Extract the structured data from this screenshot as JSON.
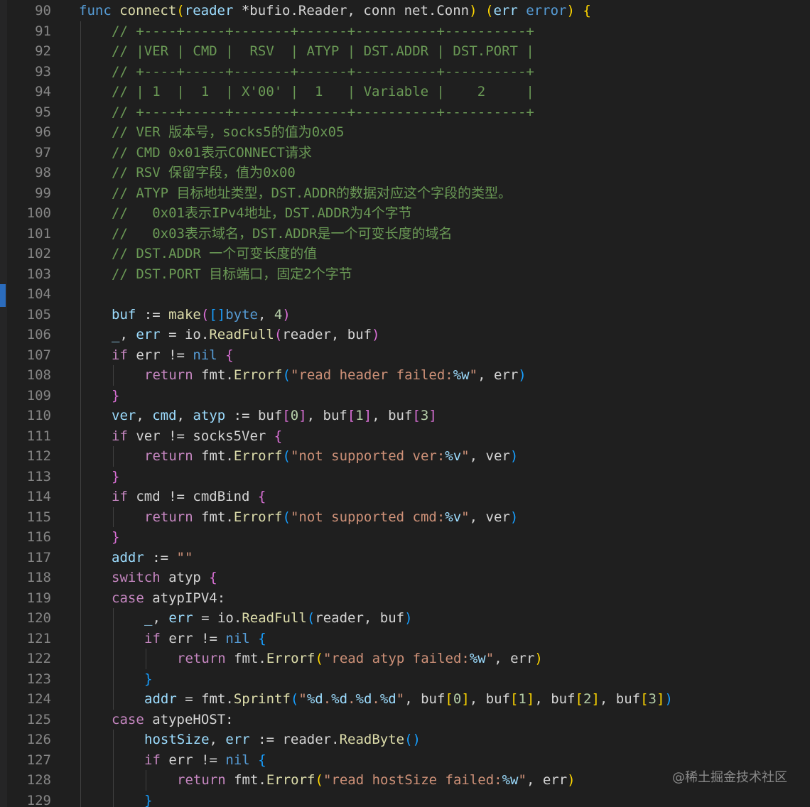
{
  "editor": {
    "lines": [
      {
        "n": "90",
        "indent": 0,
        "tokens": [
          [
            "t-kw",
            "func"
          ],
          [
            "t-plain",
            " "
          ],
          [
            "t-fn",
            "connect"
          ],
          [
            "t-b1",
            "("
          ],
          [
            "t-var",
            "reader"
          ],
          [
            "t-plain",
            " *bufio.Reader, conn net.Conn"
          ],
          [
            "t-b1",
            ")"
          ],
          [
            "t-plain",
            " "
          ],
          [
            "t-b1",
            "("
          ],
          [
            "t-var",
            "err"
          ],
          [
            "t-plain",
            " "
          ],
          [
            "t-kw",
            "error"
          ],
          [
            "t-b1",
            ")"
          ],
          [
            "t-plain",
            " "
          ],
          [
            "t-b1",
            "{"
          ]
        ]
      },
      {
        "n": "91",
        "indent": 1,
        "tokens": [
          [
            "t-com",
            "// +----+-----+-------+------+----------+----------+"
          ]
        ]
      },
      {
        "n": "92",
        "indent": 1,
        "tokens": [
          [
            "t-com",
            "// |VER | CMD |  RSV  | ATYP | DST.ADDR | DST.PORT |"
          ]
        ]
      },
      {
        "n": "93",
        "indent": 1,
        "tokens": [
          [
            "t-com",
            "// +----+-----+-------+------+----------+----------+"
          ]
        ]
      },
      {
        "n": "94",
        "indent": 1,
        "tokens": [
          [
            "t-com",
            "// | 1  |  1  | X'00' |  1   | Variable |    2     |"
          ]
        ]
      },
      {
        "n": "95",
        "indent": 1,
        "tokens": [
          [
            "t-com",
            "// +----+-----+-------+------+----------+----------+"
          ]
        ]
      },
      {
        "n": "96",
        "indent": 1,
        "tokens": [
          [
            "t-com",
            "// VER 版本号，socks5的值为0x05"
          ]
        ]
      },
      {
        "n": "97",
        "indent": 1,
        "tokens": [
          [
            "t-com",
            "// CMD 0x01表示CONNECT请求"
          ]
        ]
      },
      {
        "n": "98",
        "indent": 1,
        "tokens": [
          [
            "t-com",
            "// RSV 保留字段，值为0x00"
          ]
        ]
      },
      {
        "n": "99",
        "indent": 1,
        "tokens": [
          [
            "t-com",
            "// ATYP 目标地址类型，DST.ADDR的数据对应这个字段的类型。"
          ]
        ]
      },
      {
        "n": "100",
        "indent": 1,
        "tokens": [
          [
            "t-com",
            "//   0x01表示IPv4地址，DST.ADDR为4个字节"
          ]
        ]
      },
      {
        "n": "101",
        "indent": 1,
        "tokens": [
          [
            "t-com",
            "//   0x03表示域名，DST.ADDR是一个可变长度的域名"
          ]
        ]
      },
      {
        "n": "102",
        "indent": 1,
        "tokens": [
          [
            "t-com",
            "// DST.ADDR 一个可变长度的值"
          ]
        ]
      },
      {
        "n": "103",
        "indent": 1,
        "tokens": [
          [
            "t-com",
            "// DST.PORT 目标端口，固定2个字节"
          ]
        ]
      },
      {
        "n": "104",
        "indent": 1,
        "tokens": []
      },
      {
        "n": "105",
        "indent": 1,
        "tokens": [
          [
            "t-var",
            "buf"
          ],
          [
            "t-plain",
            " := "
          ],
          [
            "t-fn",
            "make"
          ],
          [
            "t-b2",
            "("
          ],
          [
            "t-b3",
            "[]"
          ],
          [
            "t-kw",
            "byte"
          ],
          [
            "t-plain",
            ", "
          ],
          [
            "t-num",
            "4"
          ],
          [
            "t-b2",
            ")"
          ]
        ]
      },
      {
        "n": "106",
        "indent": 1,
        "tokens": [
          [
            "t-var",
            "_"
          ],
          [
            "t-plain",
            ", "
          ],
          [
            "t-var",
            "err"
          ],
          [
            "t-plain",
            " = io."
          ],
          [
            "t-fn",
            "ReadFull"
          ],
          [
            "t-b2",
            "("
          ],
          [
            "t-plain",
            "reader, buf"
          ],
          [
            "t-b2",
            ")"
          ]
        ]
      },
      {
        "n": "107",
        "indent": 1,
        "tokens": [
          [
            "t-ctl",
            "if"
          ],
          [
            "t-plain",
            " err != "
          ],
          [
            "t-kw",
            "nil"
          ],
          [
            "t-plain",
            " "
          ],
          [
            "t-b2",
            "{"
          ]
        ]
      },
      {
        "n": "108",
        "indent": 2,
        "tokens": [
          [
            "t-ctl",
            "return"
          ],
          [
            "t-plain",
            " fmt."
          ],
          [
            "t-fn",
            "Errorf"
          ],
          [
            "t-b3",
            "("
          ],
          [
            "t-str",
            "\"read header failed:"
          ],
          [
            "t-fmt",
            "%w"
          ],
          [
            "t-str",
            "\""
          ],
          [
            "t-plain",
            ", err"
          ],
          [
            "t-b3",
            ")"
          ]
        ]
      },
      {
        "n": "109",
        "indent": 1,
        "tokens": [
          [
            "t-b2",
            "}"
          ]
        ]
      },
      {
        "n": "110",
        "indent": 1,
        "tokens": [
          [
            "t-var",
            "ver"
          ],
          [
            "t-plain",
            ", "
          ],
          [
            "t-var",
            "cmd"
          ],
          [
            "t-plain",
            ", "
          ],
          [
            "t-var",
            "atyp"
          ],
          [
            "t-plain",
            " := buf"
          ],
          [
            "t-b2",
            "["
          ],
          [
            "t-num",
            "0"
          ],
          [
            "t-b2",
            "]"
          ],
          [
            "t-plain",
            ", buf"
          ],
          [
            "t-b2",
            "["
          ],
          [
            "t-num",
            "1"
          ],
          [
            "t-b2",
            "]"
          ],
          [
            "t-plain",
            ", buf"
          ],
          [
            "t-b2",
            "["
          ],
          [
            "t-num",
            "3"
          ],
          [
            "t-b2",
            "]"
          ]
        ]
      },
      {
        "n": "111",
        "indent": 1,
        "tokens": [
          [
            "t-ctl",
            "if"
          ],
          [
            "t-plain",
            " ver != socks5Ver "
          ],
          [
            "t-b2",
            "{"
          ]
        ]
      },
      {
        "n": "112",
        "indent": 2,
        "tokens": [
          [
            "t-ctl",
            "return"
          ],
          [
            "t-plain",
            " fmt."
          ],
          [
            "t-fn",
            "Errorf"
          ],
          [
            "t-b3",
            "("
          ],
          [
            "t-str",
            "\"not supported ver:"
          ],
          [
            "t-fmt",
            "%v"
          ],
          [
            "t-str",
            "\""
          ],
          [
            "t-plain",
            ", ver"
          ],
          [
            "t-b3",
            ")"
          ]
        ]
      },
      {
        "n": "113",
        "indent": 1,
        "tokens": [
          [
            "t-b2",
            "}"
          ]
        ]
      },
      {
        "n": "114",
        "indent": 1,
        "tokens": [
          [
            "t-ctl",
            "if"
          ],
          [
            "t-plain",
            " cmd != cmdBind "
          ],
          [
            "t-b2",
            "{"
          ]
        ]
      },
      {
        "n": "115",
        "indent": 2,
        "tokens": [
          [
            "t-ctl",
            "return"
          ],
          [
            "t-plain",
            " fmt."
          ],
          [
            "t-fn",
            "Errorf"
          ],
          [
            "t-b3",
            "("
          ],
          [
            "t-str",
            "\"not supported cmd:"
          ],
          [
            "t-fmt",
            "%v"
          ],
          [
            "t-str",
            "\""
          ],
          [
            "t-plain",
            ", ver"
          ],
          [
            "t-b3",
            ")"
          ]
        ]
      },
      {
        "n": "116",
        "indent": 1,
        "tokens": [
          [
            "t-b2",
            "}"
          ]
        ]
      },
      {
        "n": "117",
        "indent": 1,
        "tokens": [
          [
            "t-var",
            "addr"
          ],
          [
            "t-plain",
            " := "
          ],
          [
            "t-str",
            "\"\""
          ]
        ]
      },
      {
        "n": "118",
        "indent": 1,
        "tokens": [
          [
            "t-ctl",
            "switch"
          ],
          [
            "t-plain",
            " atyp "
          ],
          [
            "t-b2",
            "{"
          ]
        ]
      },
      {
        "n": "119",
        "indent": 1,
        "tokens": [
          [
            "t-ctl",
            "case"
          ],
          [
            "t-plain",
            " atypIPV4:"
          ]
        ]
      },
      {
        "n": "120",
        "indent": 2,
        "tokens": [
          [
            "t-var",
            "_"
          ],
          [
            "t-plain",
            ", "
          ],
          [
            "t-var",
            "err"
          ],
          [
            "t-plain",
            " = io."
          ],
          [
            "t-fn",
            "ReadFull"
          ],
          [
            "t-b3",
            "("
          ],
          [
            "t-plain",
            "reader, buf"
          ],
          [
            "t-b3",
            ")"
          ]
        ]
      },
      {
        "n": "121",
        "indent": 2,
        "tokens": [
          [
            "t-ctl",
            "if"
          ],
          [
            "t-plain",
            " err != "
          ],
          [
            "t-kw",
            "nil"
          ],
          [
            "t-plain",
            " "
          ],
          [
            "t-b3",
            "{"
          ]
        ]
      },
      {
        "n": "122",
        "indent": 3,
        "tokens": [
          [
            "t-ctl",
            "return"
          ],
          [
            "t-plain",
            " fmt."
          ],
          [
            "t-fn",
            "Errorf"
          ],
          [
            "t-b1",
            "("
          ],
          [
            "t-str",
            "\"read atyp failed:"
          ],
          [
            "t-fmt",
            "%w"
          ],
          [
            "t-str",
            "\""
          ],
          [
            "t-plain",
            ", err"
          ],
          [
            "t-b1",
            ")"
          ]
        ]
      },
      {
        "n": "123",
        "indent": 2,
        "tokens": [
          [
            "t-b3",
            "}"
          ]
        ]
      },
      {
        "n": "124",
        "indent": 2,
        "tokens": [
          [
            "t-var",
            "addr"
          ],
          [
            "t-plain",
            " = fmt."
          ],
          [
            "t-fn",
            "Sprintf"
          ],
          [
            "t-b3",
            "("
          ],
          [
            "t-str",
            "\""
          ],
          [
            "t-fmt",
            "%d"
          ],
          [
            "t-str",
            "."
          ],
          [
            "t-fmt",
            "%d"
          ],
          [
            "t-str",
            "."
          ],
          [
            "t-fmt",
            "%d"
          ],
          [
            "t-str",
            "."
          ],
          [
            "t-fmt",
            "%d"
          ],
          [
            "t-str",
            "\""
          ],
          [
            "t-plain",
            ", buf"
          ],
          [
            "t-b1",
            "["
          ],
          [
            "t-num",
            "0"
          ],
          [
            "t-b1",
            "]"
          ],
          [
            "t-plain",
            ", buf"
          ],
          [
            "t-b1",
            "["
          ],
          [
            "t-num",
            "1"
          ],
          [
            "t-b1",
            "]"
          ],
          [
            "t-plain",
            ", buf"
          ],
          [
            "t-b1",
            "["
          ],
          [
            "t-num",
            "2"
          ],
          [
            "t-b1",
            "]"
          ],
          [
            "t-plain",
            ", buf"
          ],
          [
            "t-b1",
            "["
          ],
          [
            "t-num",
            "3"
          ],
          [
            "t-b1",
            "]"
          ],
          [
            "t-b3",
            ")"
          ]
        ]
      },
      {
        "n": "125",
        "indent": 1,
        "tokens": [
          [
            "t-ctl",
            "case"
          ],
          [
            "t-plain",
            " atypeHOST:"
          ]
        ]
      },
      {
        "n": "126",
        "indent": 2,
        "tokens": [
          [
            "t-var",
            "hostSize"
          ],
          [
            "t-plain",
            ", "
          ],
          [
            "t-var",
            "err"
          ],
          [
            "t-plain",
            " := reader."
          ],
          [
            "t-fn",
            "ReadByte"
          ],
          [
            "t-b3",
            "()"
          ]
        ]
      },
      {
        "n": "127",
        "indent": 2,
        "tokens": [
          [
            "t-ctl",
            "if"
          ],
          [
            "t-plain",
            " err != "
          ],
          [
            "t-kw",
            "nil"
          ],
          [
            "t-plain",
            " "
          ],
          [
            "t-b3",
            "{"
          ]
        ]
      },
      {
        "n": "128",
        "indent": 3,
        "tokens": [
          [
            "t-ctl",
            "return"
          ],
          [
            "t-plain",
            " fmt."
          ],
          [
            "t-fn",
            "Errorf"
          ],
          [
            "t-b1",
            "("
          ],
          [
            "t-str",
            "\"read hostSize failed:"
          ],
          [
            "t-fmt",
            "%w"
          ],
          [
            "t-str",
            "\""
          ],
          [
            "t-plain",
            ", err"
          ],
          [
            "t-b1",
            ")"
          ]
        ]
      },
      {
        "n": "129",
        "indent": 2,
        "tokens": [
          [
            "t-b3",
            "}"
          ]
        ]
      }
    ]
  },
  "watermark": "@稀土掘金技术社区",
  "colors": {
    "background": "#1f1f1f",
    "line_number": "#858585",
    "keyword": "#569cd6",
    "control": "#c586c0",
    "function": "#dcdcaa",
    "variable": "#9cdcfe",
    "string": "#ce9178",
    "number": "#b5cea8",
    "comment": "#6a9955",
    "bracket_gold": "#ffd700",
    "bracket_orchid": "#da70d6",
    "bracket_blue": "#179fff"
  }
}
